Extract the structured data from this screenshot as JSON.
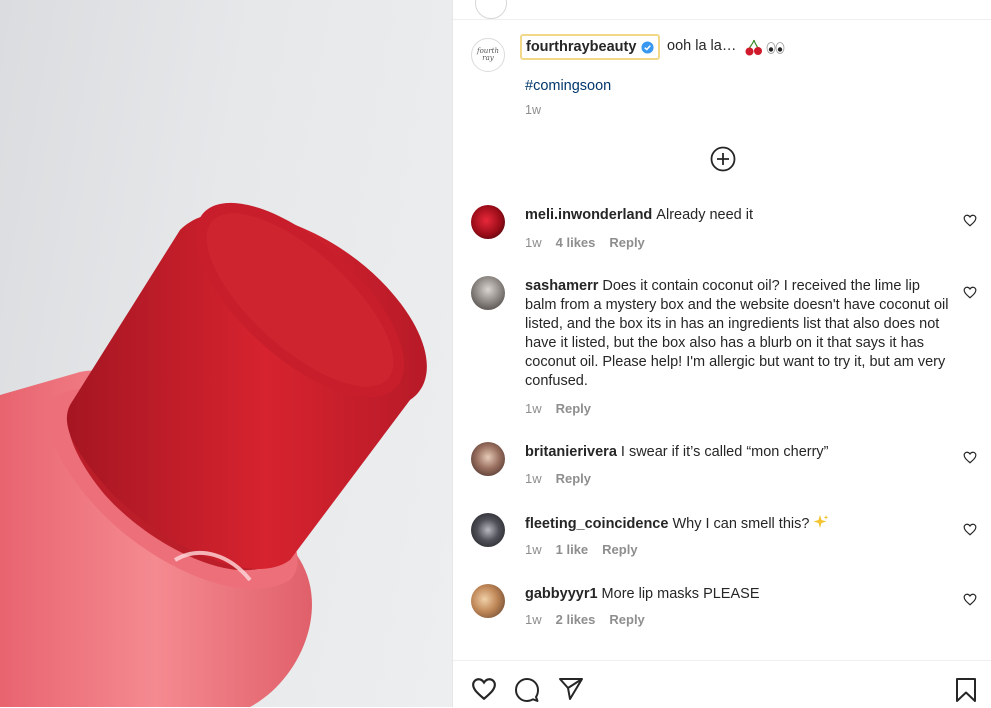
{
  "post": {
    "author": "fourthraybeauty",
    "avatar_text": "fourth ray",
    "caption": "ooh la la…",
    "caption_emoji": [
      "cherry-icon",
      "eyes-icon"
    ],
    "hashtag": "#comingsoon",
    "time": "1w"
  },
  "comments": [
    {
      "user": "meli.inwonderland",
      "text": "Already need it",
      "time": "1w",
      "likes": "4 likes",
      "reply": "Reply",
      "avatar_color": "#b01020"
    },
    {
      "user": "sashamerr",
      "text": "Does it contain coconut oil? I received the lime lip balm from a mystery box and the website doesn't have coconut oil listed, and the box its in has an ingredients list that also does not have it listed, but the box also has a blurb on it that says it has coconut oil. Please help! I'm allergic but want to try it, but am very confused.",
      "time": "1w",
      "likes": "",
      "reply": "Reply",
      "avatar_color": "#8a8a8a"
    },
    {
      "user": "britanierivera",
      "text": "I swear if it’s called “mon cherry”",
      "time": "1w",
      "likes": "",
      "reply": "Reply",
      "avatar_color": "#6b5048"
    },
    {
      "user": "fleeting_coincidence",
      "text": "Why I can smell this?",
      "emoji": "sparkles-icon",
      "time": "1w",
      "likes": "1 like",
      "reply": "Reply",
      "avatar_color": "#3a3a40"
    },
    {
      "user": "gabbyyyr1",
      "text": "More lip masks PLEASE",
      "time": "1w",
      "likes": "2 likes",
      "reply": "Reply",
      "avatar_color": "#c9a070"
    }
  ],
  "colors": {
    "link": "#00376b",
    "muted": "#8e8e8e",
    "verified": "#3897f0",
    "highlight": "#f2d98a",
    "balm_red": "#c81e2c",
    "tube_pink": "#f07a82"
  }
}
